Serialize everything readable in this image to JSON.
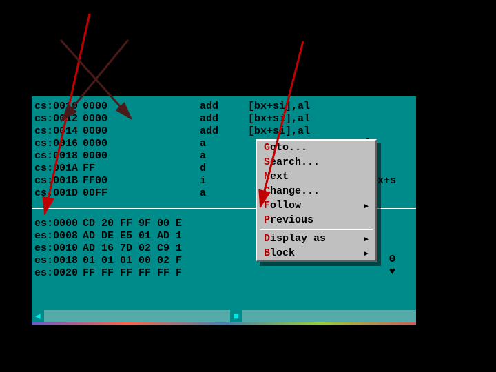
{
  "disasm": [
    {
      "seg": "cs",
      "addr": "0010",
      "bytes": "0000",
      "mnem": "add",
      "ops": "[bx+si],al"
    },
    {
      "seg": "cs",
      "addr": "0012",
      "bytes": "0000",
      "mnem": "add",
      "ops": "[bx+si],al"
    },
    {
      "seg": "cs",
      "addr": "0014",
      "bytes": "0000",
      "mnem": "add",
      "ops": "[bx+si],al"
    },
    {
      "seg": "cs",
      "addr": "0016",
      "bytes": "0000",
      "mnem": "a",
      "ops": "l"
    },
    {
      "seg": "cs",
      "addr": "0018",
      "bytes": "0000",
      "mnem": "a",
      "ops": "l"
    },
    {
      "seg": "cs",
      "addr": "001A",
      "bytes": "FF",
      "mnem": "d",
      "ops": ""
    },
    {
      "seg": "cs",
      "addr": "001B",
      "bytes": "FF00",
      "mnem": "i",
      "ops": "[bx+s"
    },
    {
      "seg": "cs",
      "addr": "001D",
      "bytes": "00FF",
      "mnem": "a",
      "ops": ""
    }
  ],
  "dump": [
    {
      "seg": "es",
      "addr": "0000",
      "hex": "CD 20 FF 9F 00 E"
    },
    {
      "seg": "es",
      "addr": "0008",
      "hex": "AD DE E5 01 AD 1"
    },
    {
      "seg": "es",
      "addr": "0010",
      "hex": "AD 16 7D 02 C9 1"
    },
    {
      "seg": "es",
      "addr": "0018",
      "hex": "01 01 01 00 02 F"
    },
    {
      "seg": "es",
      "addr": "0020",
      "hex": "FF FF FF FF FF F"
    }
  ],
  "menu": {
    "items": [
      {
        "hot": "G",
        "rest": "oto...",
        "sub": false
      },
      {
        "hot": "S",
        "rest": "earch...",
        "sub": false
      },
      {
        "hot": "N",
        "rest": "ext",
        "sub": false
      },
      {
        "hot": "C",
        "rest": "hange...",
        "sub": false
      },
      {
        "hot": "F",
        "rest": "ollow",
        "sub": true
      },
      {
        "hot": "P",
        "rest": "revious",
        "sub": false
      }
    ],
    "items2": [
      {
        "hot": "D",
        "rest": "isplay as",
        "sub": true
      },
      {
        "hot": "B",
        "rest": "lock",
        "sub": true
      }
    ]
  },
  "side": {
    "l1": "Θ",
    "l2": "♥"
  },
  "scrollbar": {
    "left": "◄",
    "thumb": "■"
  },
  "colors": {
    "bg": "#008b8b",
    "menu_bg": "#c0c0c0",
    "hotkey": "#b00000",
    "arrow_red": "#c00000",
    "arrow_dk": "#4a1a1a"
  }
}
